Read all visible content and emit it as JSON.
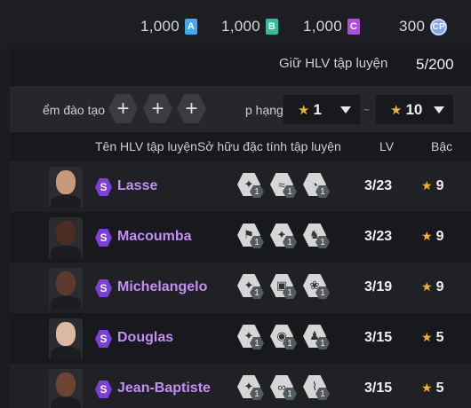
{
  "currencies": [
    {
      "amount": "1,000",
      "icon": "A",
      "color": "#3fa9f5"
    },
    {
      "amount": "1,000",
      "icon": "B",
      "color": "#2dbfa0"
    },
    {
      "amount": "1,000",
      "icon": "C",
      "color": "#b04de0"
    }
  ],
  "cp": {
    "amount": "300",
    "icon": "CP"
  },
  "keep": {
    "label": "Giữ HLV tập luyện",
    "count": "5/200"
  },
  "filter": {
    "training_label": "ểm đào tạo",
    "plus_symbol": "+",
    "rank_label": "p hạng",
    "min_rank": "1",
    "max_rank": "10",
    "tilde": "~"
  },
  "columns": {
    "name": "Tên HLV tập luyện",
    "traits": "Sở hữu đặc tính tập luyện",
    "lv": "LV",
    "grade": "Bậc"
  },
  "coaches": [
    {
      "name": "Lasse",
      "lv": "3/23",
      "grade": "9",
      "skin": "#c89a7a",
      "traits": [
        {
          "glyph": "✦",
          "level": "1"
        },
        {
          "glyph": "≈",
          "level": "1"
        },
        {
          "glyph": "◔",
          "level": "1"
        }
      ]
    },
    {
      "name": "Macoumba",
      "lv": "3/23",
      "grade": "9",
      "skin": "#4a2e22",
      "traits": [
        {
          "glyph": "⚑",
          "level": "1"
        },
        {
          "glyph": "✦",
          "level": "1"
        },
        {
          "glyph": "♞",
          "level": "1"
        }
      ]
    },
    {
      "name": "Michelangelo",
      "lv": "3/19",
      "grade": "9",
      "skin": "#5a3a2a",
      "traits": [
        {
          "glyph": "✦",
          "level": "1"
        },
        {
          "glyph": "▣",
          "level": "1"
        },
        {
          "glyph": "❀",
          "level": "1"
        }
      ]
    },
    {
      "name": "Douglas",
      "lv": "3/15",
      "grade": "5",
      "skin": "#dcb8a0",
      "traits": [
        {
          "glyph": "✦",
          "level": "1"
        },
        {
          "glyph": "◉",
          "level": "1"
        },
        {
          "glyph": "♟",
          "level": "1"
        }
      ]
    },
    {
      "name": "Jean-Baptiste",
      "lv": "3/15",
      "grade": "5",
      "skin": "#6a4533",
      "traits": [
        {
          "glyph": "✦",
          "level": "1"
        },
        {
          "glyph": "∞",
          "level": "1"
        },
        {
          "glyph": "⌇",
          "level": "1"
        }
      ]
    }
  ],
  "colors": {
    "accent_purple": "#c48ef5",
    "badge_purple": "#7d3fd9",
    "star_gold": "#f0b429"
  }
}
